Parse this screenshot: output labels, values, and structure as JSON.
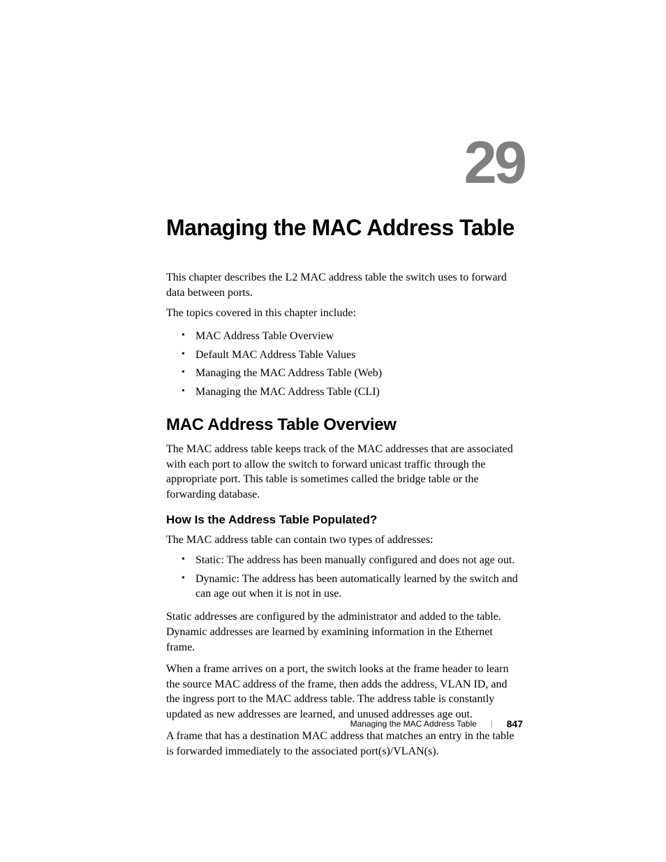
{
  "chapter": {
    "number": "29",
    "title": "Managing the MAC Address Table"
  },
  "intro": {
    "p1": "This chapter describes the L2 MAC address table the switch uses to forward data between ports.",
    "p2": "The topics covered in this chapter include:"
  },
  "topics": [
    "MAC Address Table Overview",
    "Default MAC Address Table Values",
    "Managing the MAC Address Table (Web)",
    "Managing the MAC Address Table (CLI)"
  ],
  "section1": {
    "heading": "MAC Address Table Overview",
    "p1": "The MAC address table keeps track of the MAC addresses that are associated with each port to allow the switch to forward unicast traffic through the appropriate port. This table is sometimes called the bridge table or the forwarding database.",
    "sub1": {
      "heading": "How Is the Address Table Populated?",
      "p1": "The MAC address table can contain two types of addresses:",
      "bullets": [
        "Static: The address has been manually configured and does not age out.",
        "Dynamic: The address has been automatically learned by the switch and can age out when it is not in use."
      ],
      "p2": "Static addresses are configured by the administrator and added to the table. Dynamic addresses are learned by examining information in the Ethernet frame.",
      "p3": "When a frame arrives on a port, the switch looks at the frame header to learn the source MAC address of the frame, then adds the address, VLAN ID, and the ingress port to the MAC address table. The address table is constantly updated as new addresses are learned, and unused addresses age out.",
      "p4": "A frame that has a destination MAC address that matches an entry in the table is forwarded immediately to the associated port(s)/VLAN(s)."
    }
  },
  "footer": {
    "title": "Managing the MAC Address Table",
    "page": "847"
  }
}
